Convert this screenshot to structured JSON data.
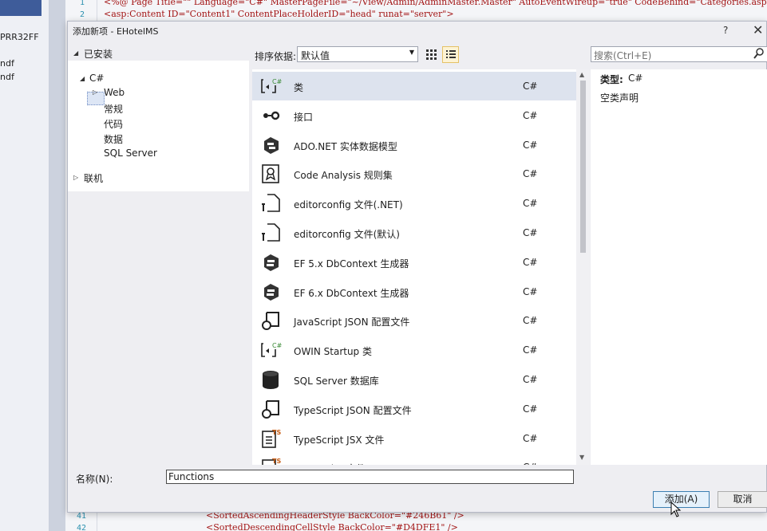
{
  "background": {
    "left_items": [
      "PRR32FF",
      "ndf",
      "ndf"
    ],
    "code_lines": [
      {
        "num": "1",
        "text": "<%@ Page Title=\"\" Language=\"C#\" MasterPageFile=\"~/View/Admin/AdminMaster.Master\" AutoEventWireup=\"true\" CodeBehind=\"Categories.aspx."
      },
      {
        "num": "2",
        "text": "<asp:Content ID=\"Content1\" ContentPlaceHolderID=\"head\" runat=\"server\">"
      },
      {
        "num": "41",
        "text": "<SortedAscendingHeaderStyle BackColor=\"#246B61\" />"
      },
      {
        "num": "42",
        "text": "<SortedDescendingCellStyle BackColor=\"#D4DFE1\" />"
      }
    ]
  },
  "dialog": {
    "title": "添加新项 - EHotelMS",
    "help": "?",
    "close": "✕"
  },
  "tree": {
    "installed": "已安装",
    "csharp": "C#",
    "web": "Web",
    "children": [
      "常规",
      "代码",
      "数据",
      "SQL Server"
    ],
    "online": "联机"
  },
  "toolbar": {
    "sort_label": "排序依据:",
    "sort_value": "默认值",
    "search_placeholder": "搜索(Ctrl+E)"
  },
  "templates": [
    {
      "name": "类",
      "lang": "C#",
      "icon": "class-icon",
      "selected": true
    },
    {
      "name": "接口",
      "lang": "C#",
      "icon": "interface-icon"
    },
    {
      "name": "ADO.NET 实体数据模型",
      "lang": "C#",
      "icon": "entity-model-icon"
    },
    {
      "name": "Code Analysis 规则集",
      "lang": "C#",
      "icon": "ruleset-icon"
    },
    {
      "name": "editorconfig 文件(.NET)",
      "lang": "C#",
      "icon": "editorconfig-icon"
    },
    {
      "name": "editorconfig 文件(默认)",
      "lang": "C#",
      "icon": "editorconfig-icon"
    },
    {
      "name": "EF 5.x DbContext 生成器",
      "lang": "C#",
      "icon": "dbcontext-icon"
    },
    {
      "name": "EF 6.x DbContext 生成器",
      "lang": "C#",
      "icon": "dbcontext-icon"
    },
    {
      "name": "JavaScript JSON 配置文件",
      "lang": "C#",
      "icon": "json-config-icon"
    },
    {
      "name": "OWIN Startup 类",
      "lang": "C#",
      "icon": "class-icon"
    },
    {
      "name": "SQL Server 数据库",
      "lang": "C#",
      "icon": "database-icon"
    },
    {
      "name": "TypeScript JSON 配置文件",
      "lang": "C#",
      "icon": "json-config-icon"
    },
    {
      "name": "TypeScript JSX 文件",
      "lang": "C#",
      "icon": "typescript-file-icon"
    },
    {
      "name": "TypeScript 文件",
      "lang": "C#",
      "icon": "typescript-file-icon"
    }
  ],
  "details": {
    "type_label": "类型:",
    "type_value": "C#",
    "description": "空类声明"
  },
  "name_field": {
    "label": "名称(N):",
    "value": "Functions"
  },
  "buttons": {
    "add": "添加(A)",
    "cancel": "取消"
  },
  "colors": {
    "accent": "#3c7fb1",
    "selection": "#dde3ee",
    "csharp_badge": "#388a34",
    "ts_badge": "#c75b12"
  }
}
